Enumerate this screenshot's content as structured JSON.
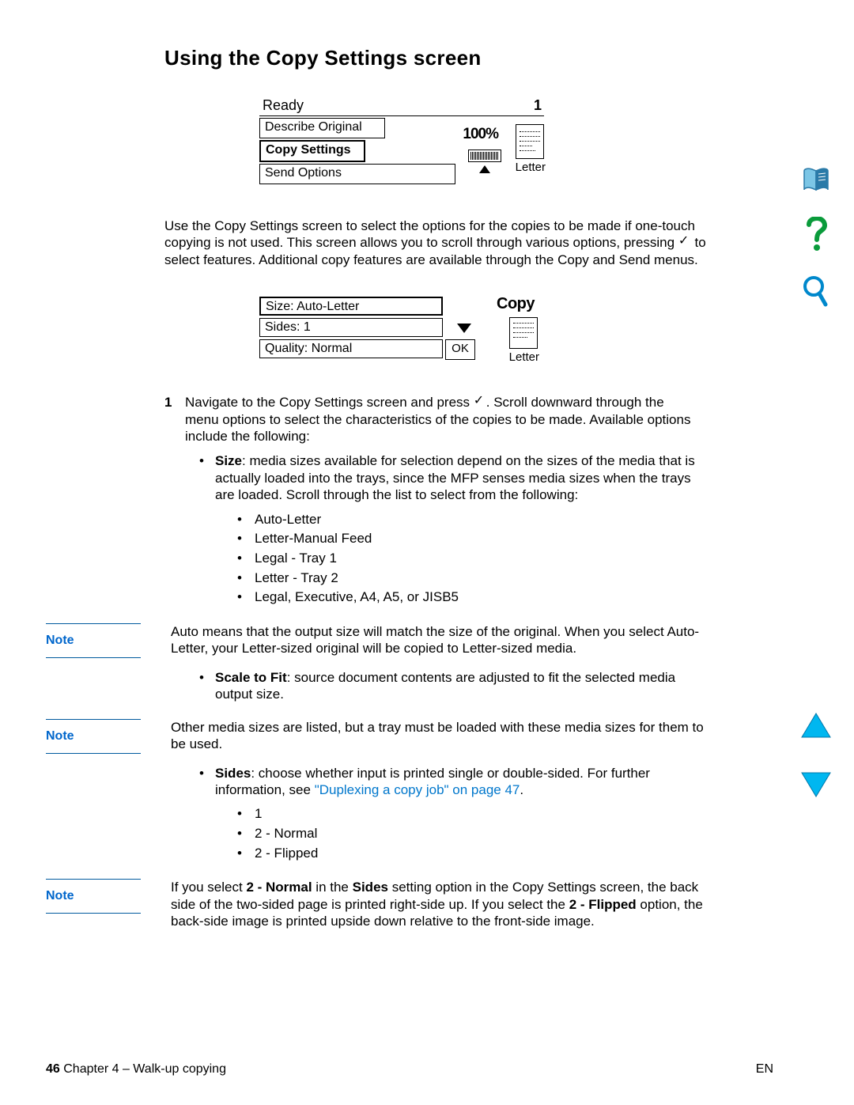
{
  "heading": "Using the Copy Settings screen",
  "screen1": {
    "status": "Ready",
    "count": "1",
    "describe": "Describe Original",
    "copy": "Copy Settings",
    "send": "Send Options",
    "zoom": "100%",
    "letter": "Letter"
  },
  "para1_a": "Use the Copy Settings screen to select the options for the copies to be made if one-touch copying is not used. This screen allows you to scroll through various options, pressing ",
  "para1_b": " to select features. Additional copy features are available through the Copy and Send menus.",
  "screen2": {
    "size": "Size: Auto-Letter",
    "sides": "Sides: 1",
    "quality": "Quality: Normal",
    "ok": "OK",
    "copy": "Copy",
    "letter": "Letter"
  },
  "step1_num": "1",
  "step1_a": "Navigate to the Copy Settings screen and press ",
  "step1_b": ". Scroll downward through the menu options to select the characteristics of the copies to be made. Available options include the following:",
  "size_label": "Size",
  "size_text": ": media sizes available for selection depend on the sizes of the media that is actually loaded into the trays, since the MFP senses media sizes when the trays are loaded. Scroll through the list to select from the following:",
  "size_opts": [
    "Auto-Letter",
    "Letter-Manual Feed",
    "Legal - Tray 1",
    "Letter - Tray 2",
    "Legal, Executive, A4, A5, or JISB5"
  ],
  "note_label": "Note",
  "note1": "Auto means that the output size will match the size of the original. When you select Auto-Letter, your Letter-sized original will be copied to Letter-sized media.",
  "scale_label": "Scale to Fit",
  "scale_text": ": source document contents are adjusted to fit the selected media output size.",
  "note2": "Other media sizes are listed, but a tray must be loaded with these media sizes for them to be used.",
  "sides_label": "Sides",
  "sides_text_a": ": choose whether input is printed single or double-sided. For further information, see ",
  "sides_link": "\"Duplexing a copy job\" on page 47",
  "sides_text_b": ".",
  "sides_opts": [
    "1",
    "2 - Normal",
    "2 - Flipped"
  ],
  "note3_a": "If you select ",
  "note3_b": "2 - Normal",
  "note3_c": " in the ",
  "note3_d": "Sides",
  "note3_e": " setting option in the Copy Settings screen, the back side of the two-sided page is printed right-side up. If you select the ",
  "note3_f": "2 - Flipped",
  "note3_g": " option, the back-side image is printed upside down relative to the front-side image.",
  "footer": {
    "page": "46",
    "chapter": " Chapter 4 – Walk-up copying",
    "lang": "EN"
  }
}
